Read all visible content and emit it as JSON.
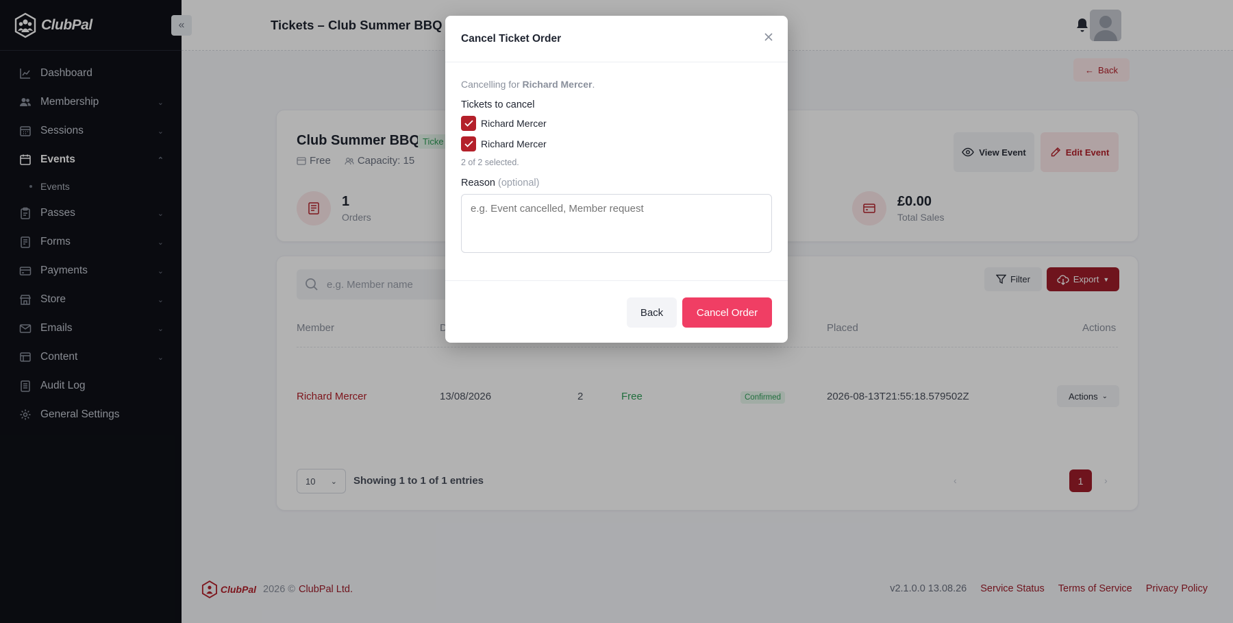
{
  "app": {
    "name": "ClubPal"
  },
  "sidebar": {
    "items": [
      {
        "label": "Dashboard",
        "icon": "chart-line-icon",
        "expandable": false
      },
      {
        "label": "Membership",
        "icon": "users-icon",
        "expandable": true
      },
      {
        "label": "Sessions",
        "icon": "calendar-grid-icon",
        "expandable": true
      },
      {
        "label": "Events",
        "icon": "calendar-icon",
        "expandable": true,
        "active": true
      },
      {
        "label": "Passes",
        "icon": "clipboard-icon",
        "expandable": true
      },
      {
        "label": "Forms",
        "icon": "form-icon",
        "expandable": true
      },
      {
        "label": "Payments",
        "icon": "card-icon",
        "expandable": true
      },
      {
        "label": "Store",
        "icon": "store-icon",
        "expandable": true
      },
      {
        "label": "Emails",
        "icon": "mail-icon",
        "expandable": true
      },
      {
        "label": "Content",
        "icon": "content-icon",
        "expandable": true
      },
      {
        "label": "Audit Log",
        "icon": "log-icon",
        "expandable": false
      },
      {
        "label": "General Settings",
        "icon": "gear-icon",
        "expandable": false
      }
    ],
    "subitems": [
      {
        "label": "Events"
      }
    ]
  },
  "header": {
    "title": "Tickets – Club Summer BBQ",
    "back_label": "Back"
  },
  "event": {
    "name": "Club Summer BBQ",
    "badge": "Ticke",
    "price": "Free",
    "capacity": "Capacity: 15",
    "view_label": "View Event",
    "edit_label": "Edit Event",
    "stats": [
      {
        "value": "1",
        "label": "Orders"
      },
      {
        "value": "£0.00",
        "label": "Total Sales"
      }
    ]
  },
  "table": {
    "search_placeholder": "e.g. Member name",
    "filter_label": "Filter",
    "export_label": "Export",
    "columns": [
      "Member",
      "D",
      "Placed",
      "Actions"
    ],
    "rows": [
      {
        "member": "Richard Mercer",
        "date": "13/08/2026",
        "qty": "2",
        "price": "Free",
        "status": "Confirmed",
        "placed": "2026-08-13T21:55:18.579502Z",
        "actions_label": "Actions"
      }
    ],
    "page_size": "10",
    "showing": "Showing 1 to 1 of 1 entries",
    "current_page": "1"
  },
  "footer": {
    "logo_text": "ClubPal",
    "copyright": "2026 ©",
    "company": "ClubPal Ltd.",
    "version": "v2.1.0.0 13.08.26",
    "links": [
      "Service Status",
      "Terms of Service",
      "Privacy Policy"
    ]
  },
  "modal": {
    "title": "Cancel Ticket Order",
    "cancelling_prefix": "Cancelling for",
    "cancelling_name": "Richard Mercer",
    "cancelling_suffix": ".",
    "tickets_label": "Tickets to cancel",
    "tickets": [
      {
        "name": "Richard Mercer",
        "checked": true
      },
      {
        "name": "Richard Mercer",
        "checked": true
      }
    ],
    "selected_count": "2 of 2 selected.",
    "reason_label": "Reason",
    "reason_optional": "(optional)",
    "reason_placeholder": "e.g. Event cancelled, Member request",
    "back_label": "Back",
    "cancel_label": "Cancel Order"
  },
  "colors": {
    "brand": "#9f1d2a",
    "cancel_button": "#f03e64",
    "success": "#2f9e58",
    "sidebar_bg": "#0f1117"
  }
}
